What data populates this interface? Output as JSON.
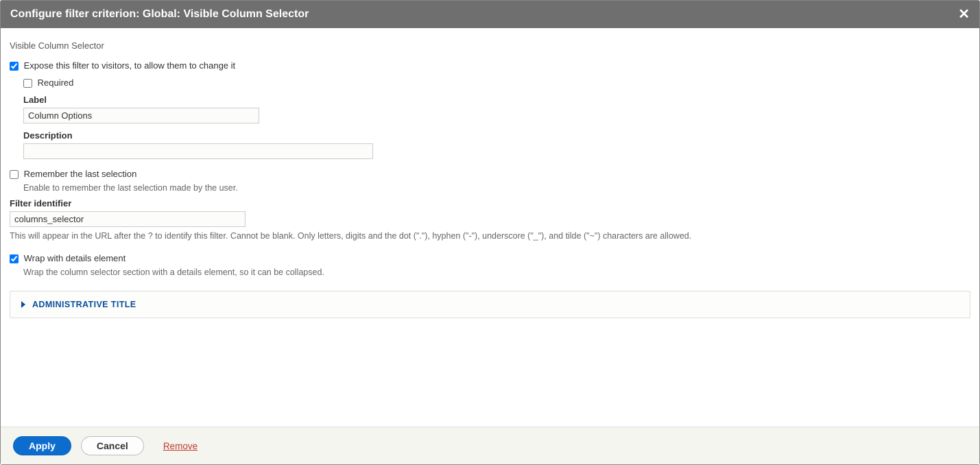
{
  "dialog": {
    "title": "Configure filter criterion: Global: Visible Column Selector",
    "close_icon": "✕"
  },
  "form": {
    "section_title": "Visible Column Selector",
    "expose": {
      "checked": true,
      "label": "Expose this filter to visitors, to allow them to change it"
    },
    "required": {
      "checked": false,
      "label": "Required"
    },
    "label_field": {
      "label": "Label",
      "value": "Column Options"
    },
    "description_field": {
      "label": "Description",
      "value": ""
    },
    "remember": {
      "checked": false,
      "label": "Remember the last selection",
      "help": "Enable to remember the last selection made by the user."
    },
    "filter_id": {
      "label": "Filter identifier",
      "value": "columns_selector",
      "help": "This will appear in the URL after the ? to identify this filter. Cannot be blank. Only letters, digits and the dot (\".\"), hyphen (\"-\"), underscore (\"_\"), and tilde (\"~\") characters are allowed."
    },
    "wrap_details": {
      "checked": true,
      "label": "Wrap with details element",
      "help": "Wrap the column selector section with a details element, so it can be collapsed."
    },
    "admin_title": {
      "summary": "Administrative title"
    }
  },
  "footer": {
    "apply": "Apply",
    "cancel": "Cancel",
    "remove": "Remove"
  }
}
